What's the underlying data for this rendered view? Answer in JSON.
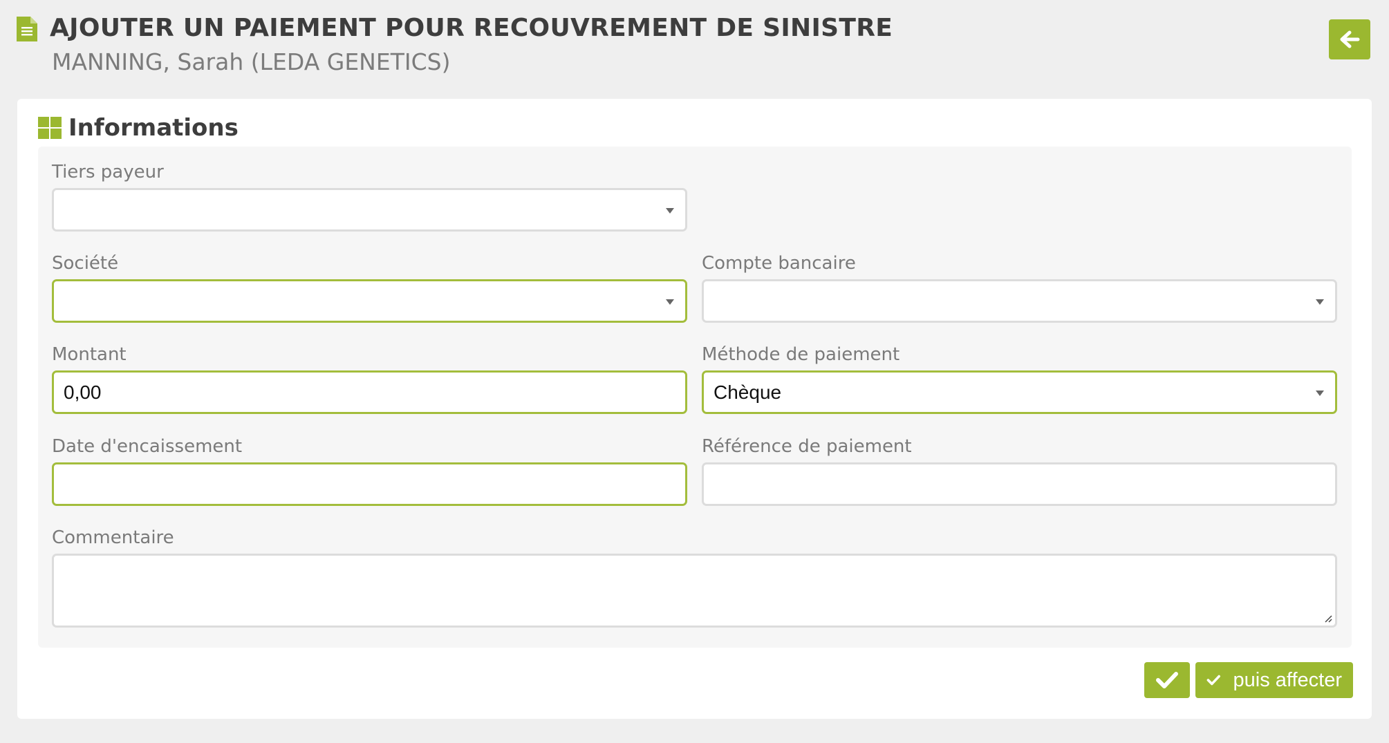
{
  "header": {
    "title": "AJOUTER UN PAIEMENT POUR RECOUVREMENT DE SINISTRE",
    "subtitle": "MANNING, Sarah (LEDA GENETICS)",
    "title_icon": "document-icon",
    "back_icon": "arrow-left-icon"
  },
  "section": {
    "title": "Informations",
    "icon": "grid-icon"
  },
  "form": {
    "tiers_payeur": {
      "label": "Tiers payeur",
      "value": ""
    },
    "societe": {
      "label": "Société",
      "value": ""
    },
    "compte_bancaire": {
      "label": "Compte bancaire",
      "value": ""
    },
    "montant": {
      "label": "Montant",
      "value": "0,00"
    },
    "methode_paiement": {
      "label": "Méthode de paiement",
      "value": "Chèque"
    },
    "date_encaissement": {
      "label": "Date d'encaissement",
      "value": ""
    },
    "reference_paiement": {
      "label": "Référence de paiement",
      "value": ""
    },
    "commentaire": {
      "label": "Commentaire",
      "value": ""
    }
  },
  "actions": {
    "save_icon": "checkmark-icon",
    "save_assign_label": "puis affecter"
  },
  "colors": {
    "accent": "#9bb830",
    "required_border": "#a3bd3c",
    "page_background": "#efefef",
    "title_text": "#3d3d3d",
    "label_text": "#7a7a7a"
  }
}
